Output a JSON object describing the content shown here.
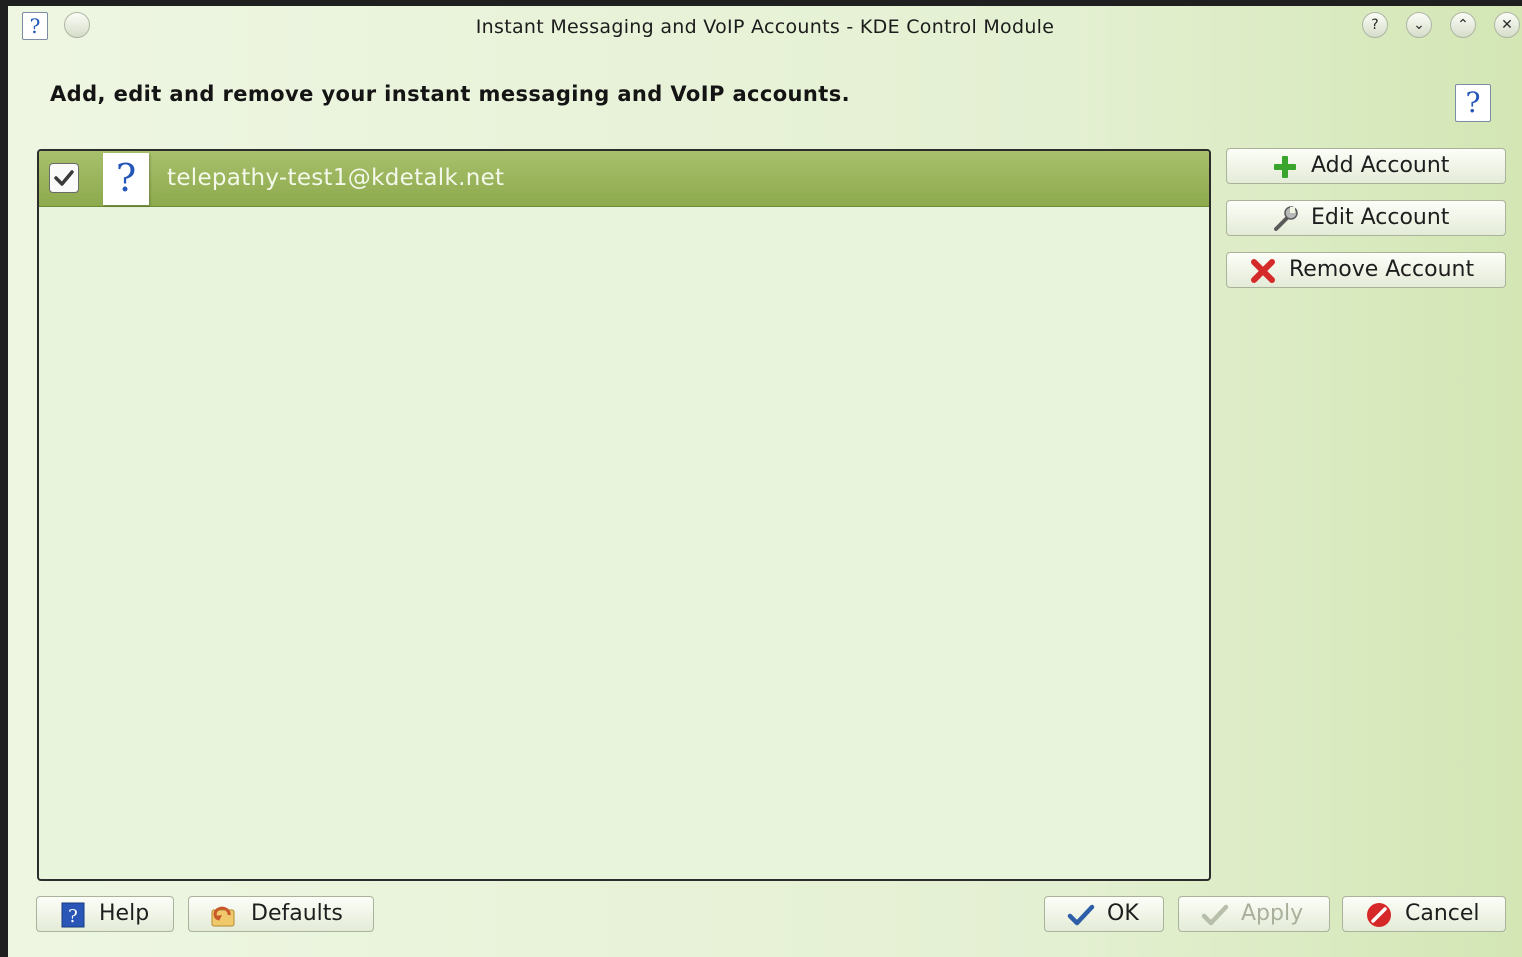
{
  "window": {
    "title": "Instant Messaging and VoIP Accounts - KDE Control Module",
    "help_glyph": "?",
    "controls": [
      "?",
      "⌄",
      "⌃",
      "✕"
    ]
  },
  "header": {
    "heading": "Add, edit and remove your instant messaging and VoIP accounts.",
    "whats_this_glyph": "?"
  },
  "accounts": [
    {
      "label": "telepathy-test1@kdetalk.net",
      "enabled": true,
      "icon": "question-document-icon",
      "icon_glyph": "?"
    }
  ],
  "side_buttons": {
    "add": "Add Account",
    "edit": "Edit Account",
    "remove": "Remove Account"
  },
  "bottom_buttons": {
    "help": "Help",
    "defaults": "Defaults",
    "ok": "OK",
    "apply": "Apply",
    "cancel": "Cancel"
  },
  "colors": {
    "selection": "#96b258",
    "list_bg": "#e8f4db",
    "add_icon": "#3aa52c",
    "remove_icon": "#d42a2a",
    "ok_icon": "#2d5ea8",
    "cancel_icon": "#d62828"
  }
}
